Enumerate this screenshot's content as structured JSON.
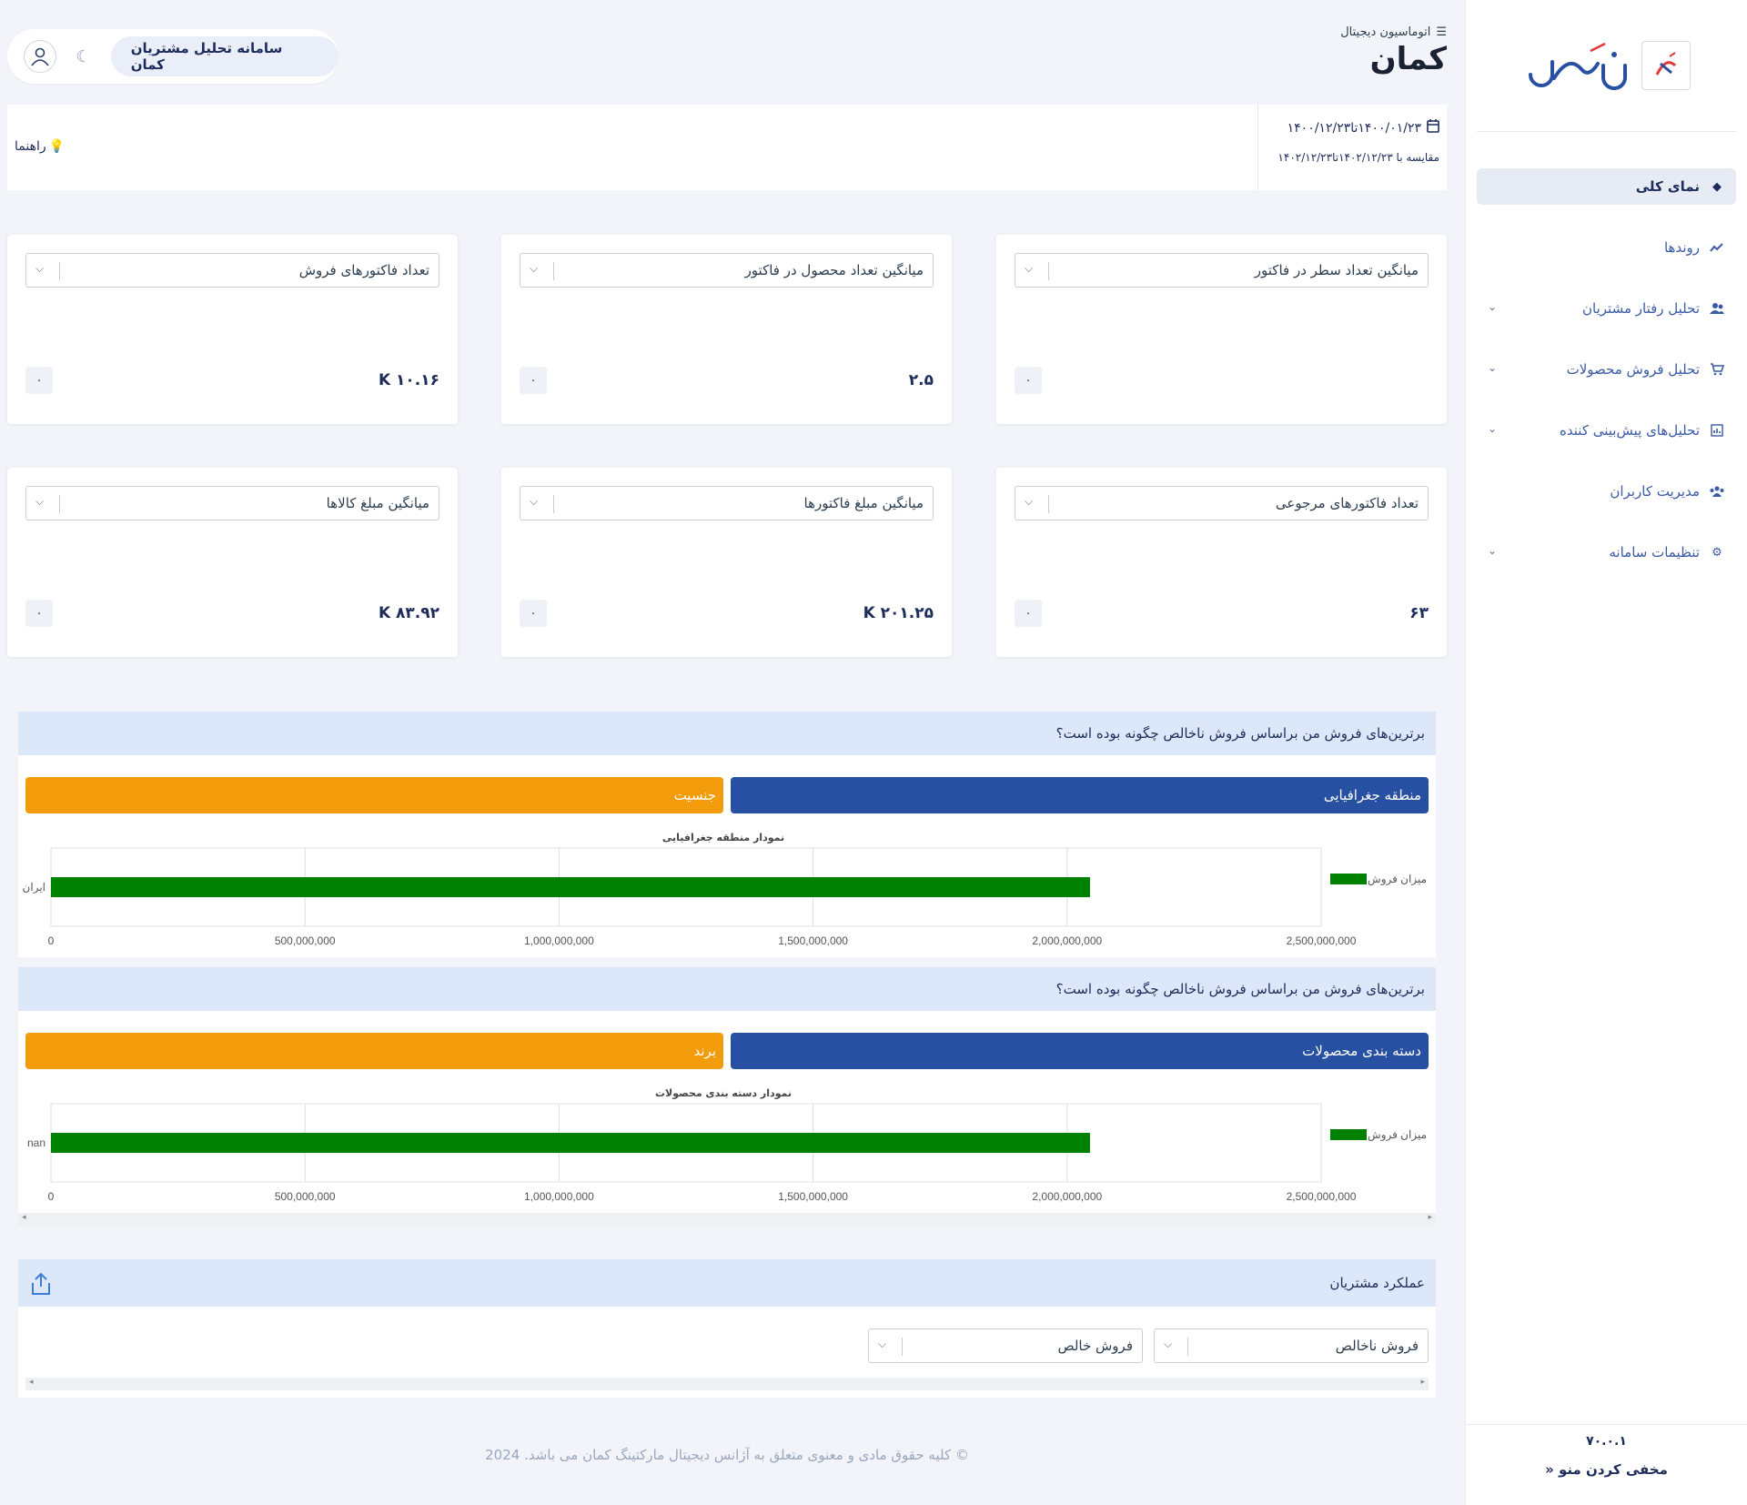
{
  "sidebar": {
    "logo_text": "کمان",
    "items": [
      {
        "label": "نمای کلی",
        "icon": "layers-icon",
        "active": true,
        "chevron": false
      },
      {
        "label": "روندها",
        "icon": "trend-icon",
        "active": false,
        "chevron": false
      },
      {
        "label": "تحلیل رفتار مشتریان",
        "icon": "users-icon",
        "active": false,
        "chevron": true
      },
      {
        "label": "تحلیل فروش محصولات",
        "icon": "cart-icon",
        "active": false,
        "chevron": true
      },
      {
        "label": "تحلیل‌های پیش‌بینی کننده",
        "icon": "chart-icon",
        "active": false,
        "chevron": true
      },
      {
        "label": "مدیریت کاربران",
        "icon": "team-icon",
        "active": false,
        "chevron": false
      },
      {
        "label": "تنظیمات سامانه",
        "icon": "gear-icon",
        "active": false,
        "chevron": true
      }
    ],
    "version": "۷۰.۰.۱",
    "hide_menu": "مخفی کردن منو"
  },
  "header": {
    "breadcrumb": "اتوماسیون دیجیتال",
    "title": "کمان",
    "system_name": "سامانه تحلیل مشتریان کمان"
  },
  "date_bar": {
    "range": "۱۴۰۰/۰۱/۲۳تا۱۴۰۰/۱۲/۲۳",
    "compare": "مقایسه با ۱۴۰۲/۱۲/۲۳تا۱۴۰۲/۱۲/۲۳",
    "guide": "راهنما"
  },
  "cards": [
    {
      "label": "میانگین تعداد سطر در فاکتور",
      "value": "",
      "badge": "۰"
    },
    {
      "label": "میانگین تعداد محصول در فاکتور",
      "value": "۲.۵",
      "badge": "۰"
    },
    {
      "label": "تعداد فاکتورهای فروش",
      "value": "K ۱۰.۱۶",
      "badge": "۰"
    },
    {
      "label": "تعداد فاکتورهای مرجوعی",
      "value": "۶۳",
      "badge": "۰"
    },
    {
      "label": "میانگین مبلغ فاکتورها",
      "value": "K ۲۰۱.۲۵",
      "badge": "۰"
    },
    {
      "label": "میانگین مبلغ کالاها",
      "value": "K ۸۳.۹۲",
      "badge": "۰"
    }
  ],
  "panels": [
    {
      "question": "برترین‌های فروش من براساس فروش ناخالص چگونه بوده است؟",
      "tab_blue": "منطقه جغرافیایی",
      "tab_orange": "جنسیت"
    },
    {
      "question": "برترین‌های فروش من براساس فروش ناخالص چگونه بوده است؟",
      "tab_blue": "دسته بندی محصولات",
      "tab_orange": "برند"
    }
  ],
  "chart_data": [
    {
      "type": "bar",
      "orientation": "horizontal",
      "title": "نمودار منطقه جغرافیایی",
      "categories": [
        "ایران"
      ],
      "series": [
        {
          "name": "میزان فروش",
          "values": [
            2045000000
          ],
          "color": "#008000"
        }
      ],
      "xlim": [
        0,
        2500000000
      ],
      "x_ticks": [
        "0",
        "500,000,000",
        "1,000,000,000",
        "1,500,000,000",
        "2,000,000,000",
        "2,500,000,000"
      ],
      "grid": true,
      "legend": "right"
    },
    {
      "type": "bar",
      "orientation": "horizontal",
      "title": "نمودار دسته بندی محصولات",
      "categories": [
        "nan"
      ],
      "series": [
        {
          "name": "میزان فروش",
          "values": [
            2045000000
          ],
          "color": "#008000"
        }
      ],
      "xlim": [
        0,
        2500000000
      ],
      "x_ticks": [
        "0",
        "500,000,000",
        "1,000,000,000",
        "1,500,000,000",
        "2,000,000,000",
        "2,500,000,000"
      ],
      "grid": true,
      "legend": "right"
    }
  ],
  "performance": {
    "title": "عملکرد مشتریان",
    "select_gross": "فروش ناخالص",
    "select_net": "فروش خالص"
  },
  "footer": "© کلیه حقوق مادی و معنوی متعلق به آژانس دیجیتال مارکتینگ کمان می باشد. 2024",
  "colors": {
    "primary": "#2850a2",
    "accent": "#f39c0b",
    "bar": "#008000",
    "panel_head": "#dce8fa"
  }
}
